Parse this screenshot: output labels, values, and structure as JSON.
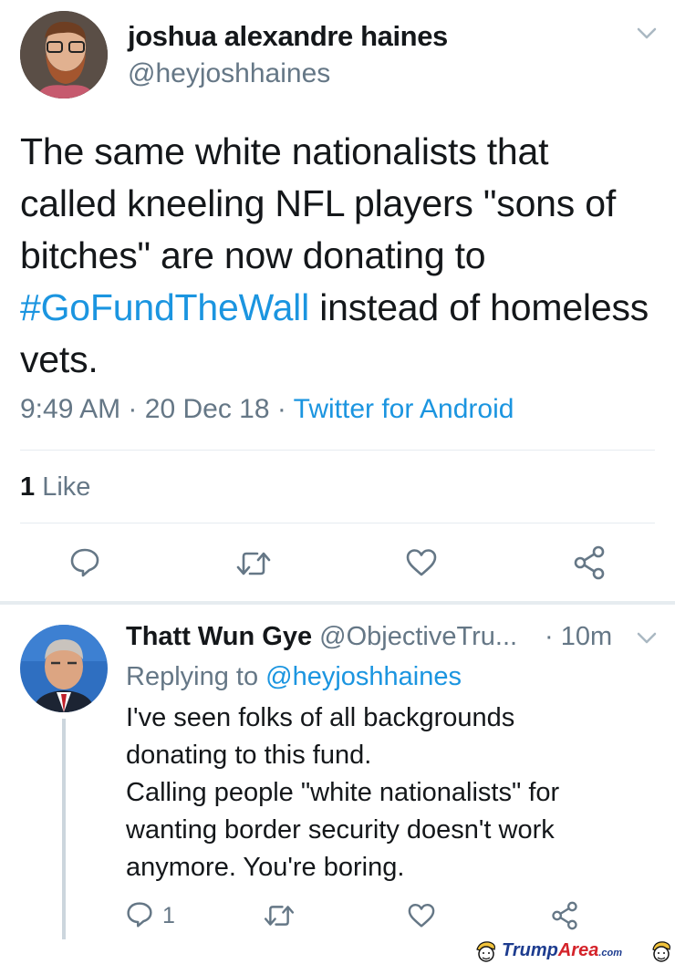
{
  "tweet": {
    "author_name": "joshua alexandre haines",
    "author_handle": "@heyjoshhaines",
    "text_before": "The same white nationalists that called kneeling NFL players \"sons of bitches\" are now donating to ",
    "hashtag": "#GoFundTheWall",
    "text_after": " instead of homeless vets.",
    "time": "9:49 AM",
    "date": "20 Dec 18",
    "source": "Twitter for Android",
    "sep": "·",
    "like_count": "1",
    "like_label": "Like"
  },
  "reply": {
    "author_name": "Thatt Wun Gye",
    "author_handle": "@ObjectiveTru...",
    "age": "10m",
    "sep": "·",
    "replying_label": "Replying to",
    "replying_handle": "@heyjoshhaines",
    "text_lines": [
      "I've seen folks of all backgrounds",
      "donating to this fund.",
      "Calling people \"white nationalists\" for",
      "wanting border security doesn't work",
      "anymore. You're boring."
    ],
    "reply_count": "1"
  },
  "watermark": {
    "part1": "Trump",
    "part2": "Area",
    "suffix": ".com"
  },
  "colors": {
    "link": "#1b95e0",
    "muted": "#657786",
    "text": "#14171a",
    "divider": "#e6ecf0",
    "watermark_blue": "#1d3c8f",
    "watermark_red": "#d4232a"
  }
}
